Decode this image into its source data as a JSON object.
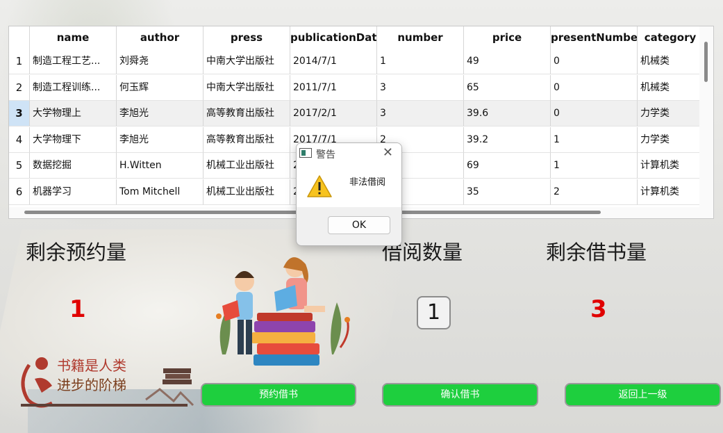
{
  "table": {
    "columns": [
      "name",
      "author",
      "press",
      "publicationDate",
      "number",
      "price",
      "presentNumber",
      "category"
    ],
    "rows": [
      {
        "index": "1",
        "cells": [
          "制造工程工艺...",
          "刘舜尧",
          "中南大学出版社",
          "2014/7/1",
          "1",
          "49",
          "0",
          "机械类"
        ]
      },
      {
        "index": "2",
        "cells": [
          "制造工程训练...",
          "何玉辉",
          "中南大学出版社",
          "2011/7/1",
          "3",
          "65",
          "0",
          "机械类"
        ]
      },
      {
        "index": "3",
        "cells": [
          "大学物理上",
          "李旭光",
          "高等教育出版社",
          "2017/2/1",
          "3",
          "39.6",
          "0",
          "力学类"
        ]
      },
      {
        "index": "4",
        "cells": [
          "大学物理下",
          "李旭光",
          "高等教育出版社",
          "2017/7/1",
          "2",
          "39.2",
          "1",
          "力学类"
        ]
      },
      {
        "index": "5",
        "cells": [
          "数据挖掘",
          "H.Witten",
          "机械工业出版社",
          "2",
          "",
          "69",
          "1",
          "计算机类"
        ]
      },
      {
        "index": "6",
        "cells": [
          "机器学习",
          "Tom Mitchell",
          "机械工业出版社",
          "2",
          "",
          "35",
          "2",
          "计算机类"
        ]
      }
    ],
    "selected_row": "3"
  },
  "labels": {
    "remaining_reservation": "剩余预约量",
    "borrow_quantity": "借阅数量",
    "remaining_borrow": "剩余借书量"
  },
  "values": {
    "remaining_reservation": "1",
    "borrow_quantity": "1",
    "remaining_borrow": "3"
  },
  "buttons": {
    "reserve": "预约借书",
    "confirm_borrow": "确认借书",
    "back": "返回上一级"
  },
  "logo": {
    "line1": "书籍是人类",
    "line2": "进步的阶梯"
  },
  "dialog": {
    "title": "警告",
    "message": "非法借阅",
    "ok_label": "OK",
    "close_glyph": "✕"
  },
  "colors": {
    "accent_green": "#1ecf3e",
    "number_red": "#e00000",
    "selected_header": "#cfe3f6"
  }
}
